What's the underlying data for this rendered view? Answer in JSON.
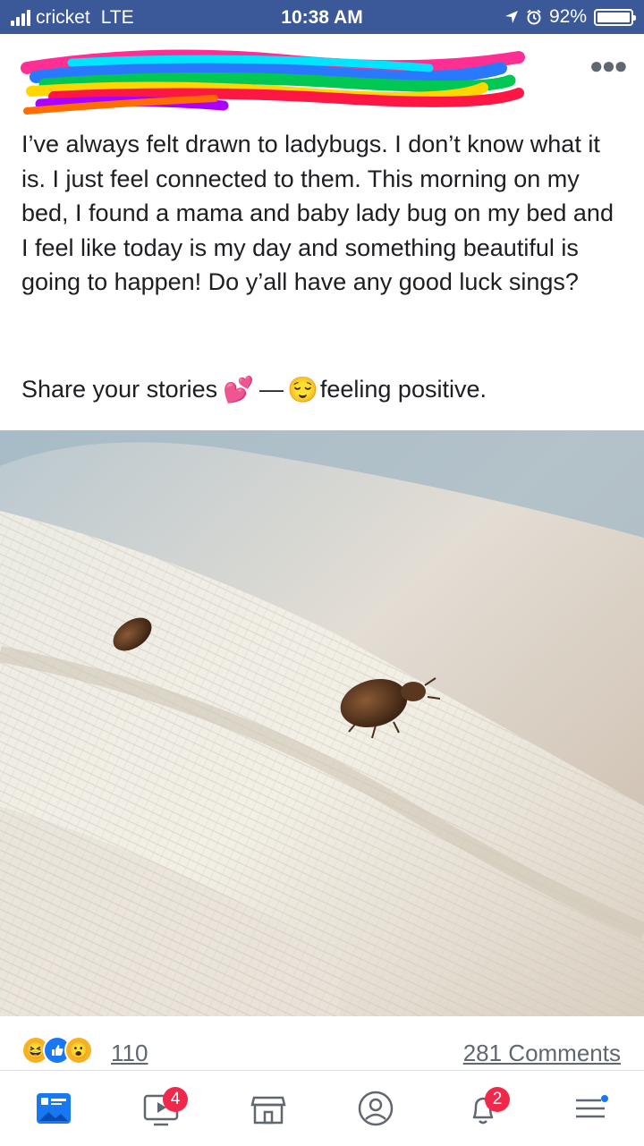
{
  "status_bar": {
    "carrier": "cricket",
    "network": "LTE",
    "time": "10:38 AM",
    "battery": "92%",
    "battery_level": 0.92
  },
  "post": {
    "text": "I’ve always felt drawn to ladybugs. I don’t know what it is. I just feel connected to them. This morning on my bed, I found a mama and baby lady bug on my bed and I feel like today is my day and something beautiful is going to happen! Do y’all have any good luck sings?",
    "share_prefix": "Share your stories",
    "share_emoji": "💕",
    "dash": "—",
    "feeling_emoji": "😌",
    "feeling": "feeling positive."
  },
  "reactions": {
    "count": "110",
    "comments": "281 Comments"
  },
  "nav": {
    "video_badge": "4",
    "notifications_badge": "2"
  },
  "colors": {
    "brand": "#3b5998",
    "accent": "#1877f2",
    "badge": "#f02849"
  }
}
